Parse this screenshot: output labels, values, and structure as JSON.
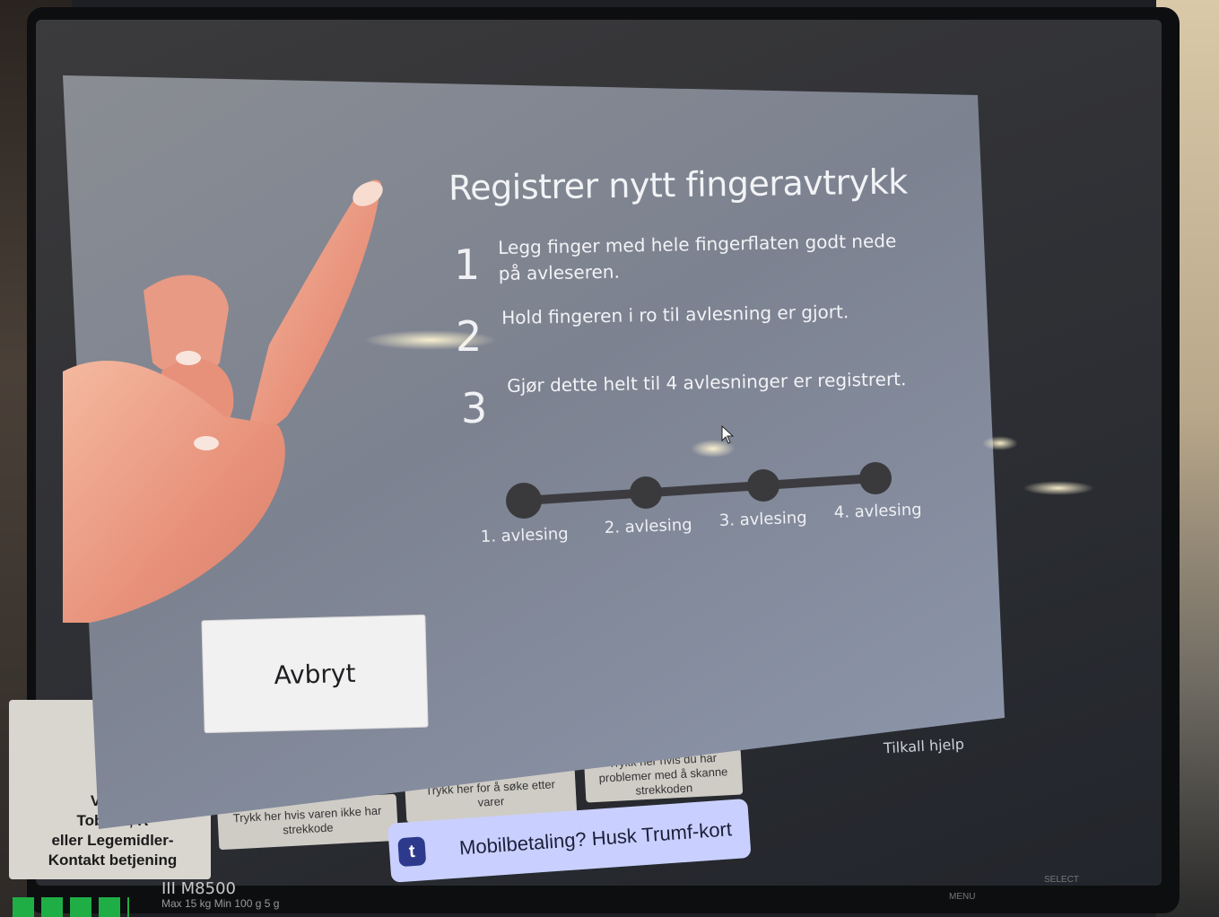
{
  "colors": {
    "modal_bg": "#868b96",
    "progress_dot": "#3a3a3c",
    "cancel_bg": "#f1f1f2",
    "trumf_bg": "#c9d0ff",
    "trumf_logo": "#2d3a8c"
  },
  "modal": {
    "title": "Registrer nytt fingeravtrykk",
    "steps": [
      {
        "number": "1",
        "text": "Legg finger med hele fingerflaten godt nede på avleseren."
      },
      {
        "number": "2",
        "text": "Hold fingeren i ro til avlesning er gjort."
      },
      {
        "number": "3",
        "text": "Gjør dette helt til 4 avlesninger er registrert."
      }
    ],
    "progress": {
      "labels": [
        "1. avlesing",
        "2. avlesing",
        "3. avlesing",
        "4. avlesing"
      ],
      "completed": 0
    },
    "cancel_label": "Avbryt"
  },
  "background": {
    "left_panel_label": "Ved kj\nTobakk, R\neller Legemidler-\nKontakt betjening",
    "buttons": [
      "Trykk her hvis varen ikke har strekkode",
      "Trykk her for å søke etter varer",
      "Trykk her hvis du har problemer med å skanne strekkoden"
    ],
    "help_label": "Tilkall hjelp",
    "trumf_logo_letter": "t",
    "trumf_text": "Mobilbetaling? Husk Trumf-kort",
    "scale_model": "III  M8500",
    "scale_specs": "Max 15 kg  Min 100 g  5 g"
  },
  "hardware": {
    "menu_label": "MENU",
    "select_label": "SELECT"
  }
}
